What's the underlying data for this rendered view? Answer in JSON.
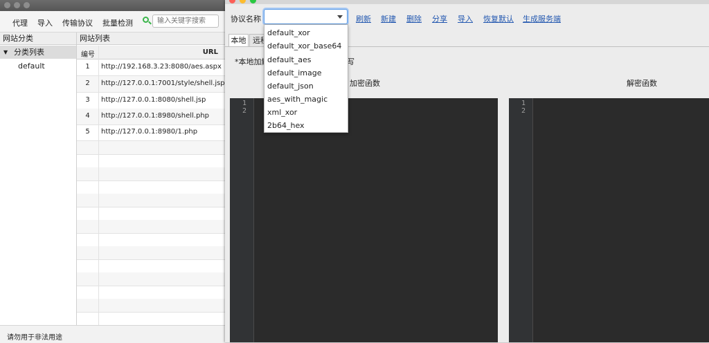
{
  "main": {
    "toolbar": {
      "proxy": "代理",
      "import": "导入",
      "transport": "传输协议",
      "batch": "批量检测",
      "search_placeholder": "输入关键字搜索"
    },
    "category_panel": {
      "title": "网站分类",
      "root": "分类列表",
      "child": "default"
    },
    "site_panel": {
      "title": "网站列表",
      "columns": {
        "num": "编号",
        "url": "URL"
      },
      "rows": [
        {
          "num": "1",
          "url": "http://192.168.3.23:8080/aes.aspx"
        },
        {
          "num": "2",
          "url": "http://127.0.0.1:7001/style/shell.jsp"
        },
        {
          "num": "3",
          "url": "http://127.0.0.1:8080/shell.jsp"
        },
        {
          "num": "4",
          "url": "http://127.0.0.1:8980/shell.php"
        },
        {
          "num": "5",
          "url": "http://127.0.0.1:8980/1.php"
        }
      ]
    },
    "status": "请勿用于非法用途"
  },
  "dialog": {
    "protocol_label": "协议名称",
    "actions": {
      "refresh": "刷新",
      "new": "新建",
      "delete": "删除",
      "share": "分享",
      "import": "导入",
      "restore": "恢复默认",
      "generate": "生成服务端"
    },
    "tabs": {
      "local": "本地",
      "remote": "远程"
    },
    "local_note": "*本地加解",
    "local_note_tail": "写",
    "encrypt_title": "加密函数",
    "decrypt_title": "解密函数",
    "line_numbers": [
      "1",
      "2"
    ],
    "protocol_options": [
      "default_xor",
      "default_xor_base64",
      "default_aes",
      "default_image",
      "default_json",
      "aes_with_magic",
      "xml_xor",
      "2b64_hex"
    ]
  }
}
